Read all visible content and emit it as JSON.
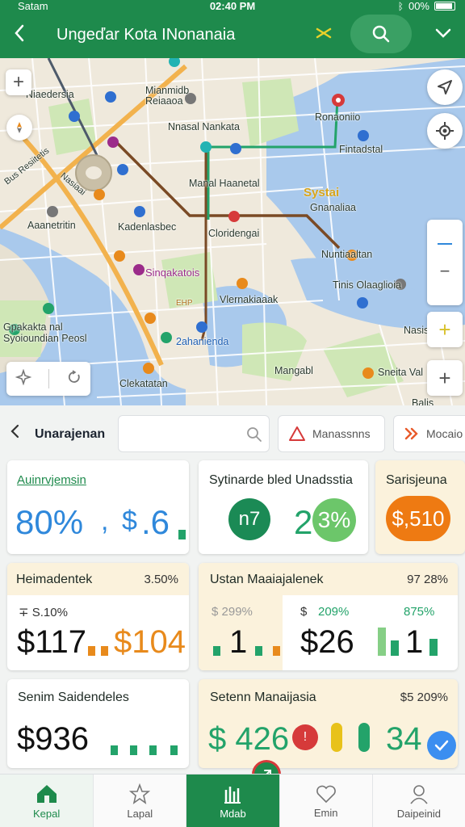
{
  "status": {
    "carrier": "Satam",
    "time": "02:40 PM",
    "battery": "00%"
  },
  "appbar": {
    "title": "Ungeďar Kota INonanaia"
  },
  "map": {
    "labels": [
      "Niaedersia",
      "Mianmidb\nReiaaoa",
      "Nnasal Nankata",
      "Ronaoniio",
      "Fintadstal",
      "Bus Resiitetis",
      "Nasiaai",
      "Manal Haanetal",
      "Systai",
      "Gnanaliaa",
      "Kadenlasbec",
      "Aaanetritin",
      "Sinqakatois",
      "Cloridengai",
      "Nuntiaaltan",
      "Tinis Olaaglioia",
      "Vlernakiaaak",
      "Gpakakta nal\nSyoioundian Peosl",
      "2ahanienda",
      "Nasis",
      "Mangabl",
      "Sneita Val",
      "Clekatatan",
      "Balis",
      "EHP"
    ]
  },
  "filter": {
    "back_label": "Unarajenan",
    "search_placeholder": "",
    "chip1": "Manassnns",
    "chip2": "Mocaio"
  },
  "cards": {
    "c1": {
      "title": "Auinrvjemsin",
      "value_a": "80%",
      "value_sep": ",",
      "value_b": "$",
      "value_c": ".6"
    },
    "c2": {
      "title": "Sytinarde bled Unadsstia",
      "badge": "n7",
      "num": "2",
      "pct": "3%"
    },
    "c3": {
      "title": "Sarisjeuna",
      "value": "$,510"
    },
    "c4": {
      "title": "Heimadentek",
      "pct": "3.50%",
      "sub": "∓ S.10%",
      "value_a": "$117",
      "value_b": "$104"
    },
    "c5": {
      "title": "Ustan Maaiajalenek",
      "pct": "97 28%",
      "sub_a": "$ 299%",
      "sub_b": "209%",
      "sub_c": "875%",
      "value_a": "1",
      "value_b": "$26",
      "value_c": "1"
    },
    "c6": {
      "title": "Senim Saidendeles",
      "value": "$936"
    },
    "c7": {
      "title": "Setenn Manaijasia",
      "pct": "$5 209%",
      "value_a": "$ 426",
      "value_b": "34"
    }
  },
  "nav": [
    {
      "label": "Kepal"
    },
    {
      "label": "Lapal"
    },
    {
      "label": "Mdab"
    },
    {
      "label": "Emin"
    },
    {
      "label": "Daipeinid"
    }
  ],
  "colors": {
    "brand": "#1e8a4c",
    "blue": "#2f88db",
    "orange": "#e88a1c",
    "red": "#d63a3a",
    "cream": "#fbf2dc"
  }
}
